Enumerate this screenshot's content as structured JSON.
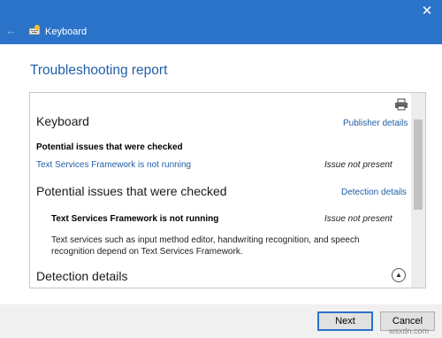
{
  "window": {
    "title": "Keyboard",
    "back_icon": "back-arrow-icon",
    "close_glyph": "✕",
    "accent_color": "#2b73c9"
  },
  "page": {
    "heading": "Troubleshooting report"
  },
  "report": {
    "section_keyboard": {
      "title": "Keyboard",
      "link": "Publisher details",
      "subheading": "Potential issues that were checked",
      "issue_name": "Text Services Framework is not running",
      "issue_status": "Issue not present"
    },
    "section_issues": {
      "title": "Potential issues that were checked",
      "link": "Detection details",
      "issue_name": "Text Services Framework is not running",
      "issue_status": "Issue not present",
      "description": "Text services such as input method editor, handwriting recognition, and speech recognition depend on Text Services Framework."
    },
    "section_detection": {
      "title": "Detection details",
      "collapse_glyph": "▲"
    }
  },
  "buttons": {
    "next": "Next",
    "cancel": "Cancel"
  },
  "watermark": "wsxdn.com"
}
